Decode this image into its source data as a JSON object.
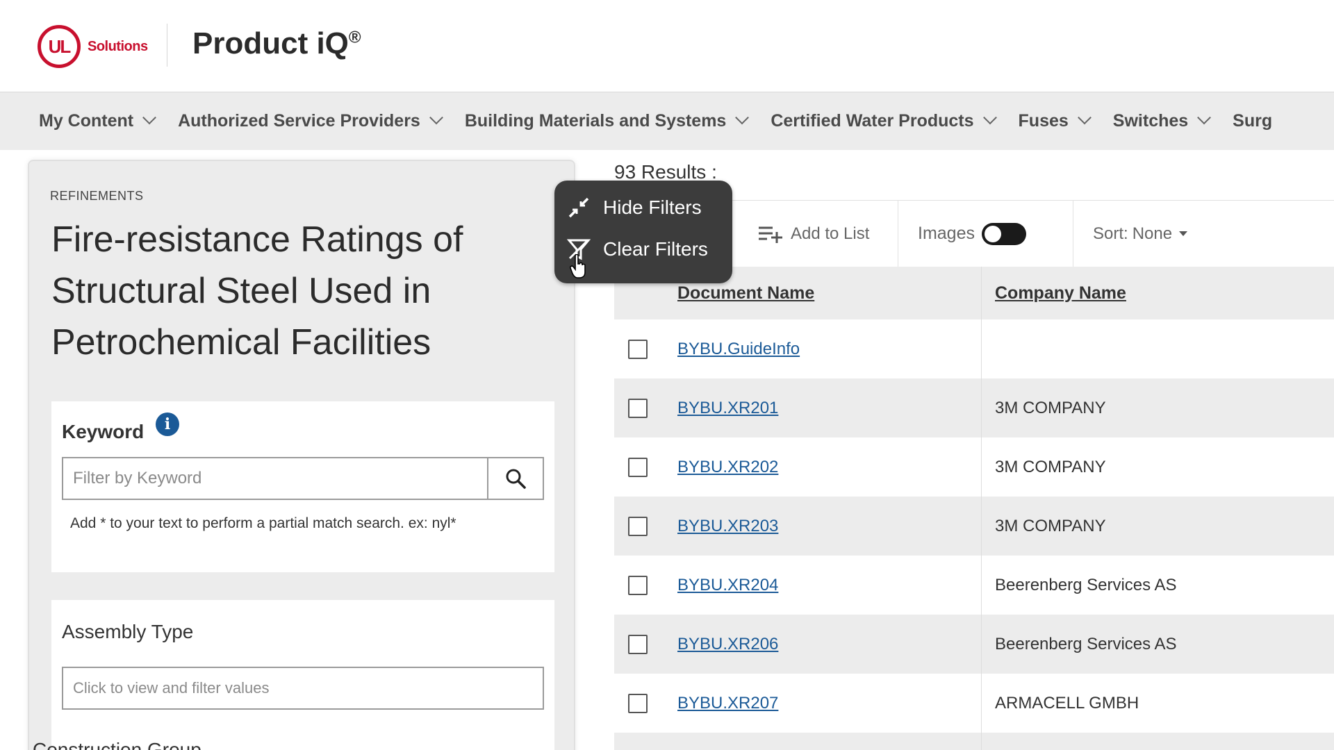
{
  "header": {
    "logo_mark": "UL",
    "logo_text": "Solutions",
    "app_title": "Product iQ",
    "app_title_mark": "®"
  },
  "nav": {
    "items": [
      {
        "label": "My Content"
      },
      {
        "label": "Authorized Service Providers"
      },
      {
        "label": "Building Materials and Systems"
      },
      {
        "label": "Certified Water Products"
      },
      {
        "label": "Fuses"
      },
      {
        "label": "Switches"
      },
      {
        "label": "Surg"
      }
    ]
  },
  "refinements": {
    "eyebrow": "REFINEMENTS",
    "heading": "Fire-resistance Ratings of Structural Steel Used in Petrochemical Facilities",
    "keyword": {
      "label": "Keyword",
      "info_icon": "info-icon",
      "placeholder": "Filter by Keyword",
      "hint": "Add * to your text to perform a partial match search. ex: nyl*"
    },
    "assembly_type": {
      "label": "Assembly Type",
      "placeholder": "Click to view and filter values"
    },
    "construction_group": {
      "label": "Construction Group"
    }
  },
  "filter_menu": {
    "hide_label": "Hide Filters",
    "clear_label": "Clear Filters"
  },
  "results": {
    "count_text": "93 Results :",
    "toolbar": {
      "add_to_list": "Add to List",
      "images_label": "Images",
      "images_on": false,
      "sort_label": "Sort:",
      "sort_value": "None"
    },
    "columns": [
      "Document Name",
      "Company Name"
    ],
    "rows": [
      {
        "doc": "BYBU.GuideInfo",
        "company": ""
      },
      {
        "doc": "BYBU.XR201",
        "company": "3M COMPANY"
      },
      {
        "doc": "BYBU.XR202",
        "company": "3M COMPANY"
      },
      {
        "doc": "BYBU.XR203",
        "company": "3M COMPANY"
      },
      {
        "doc": "BYBU.XR204",
        "company": "Beerenberg Services AS"
      },
      {
        "doc": "BYBU.XR206",
        "company": "Beerenberg Services AS"
      },
      {
        "doc": "BYBU.XR207",
        "company": "ARMACELL GMBH"
      }
    ]
  },
  "colors": {
    "brand": "#c8102e",
    "link": "#1b5a97",
    "nav_bg": "#ececec",
    "menu_bg": "#3c3c3c"
  }
}
